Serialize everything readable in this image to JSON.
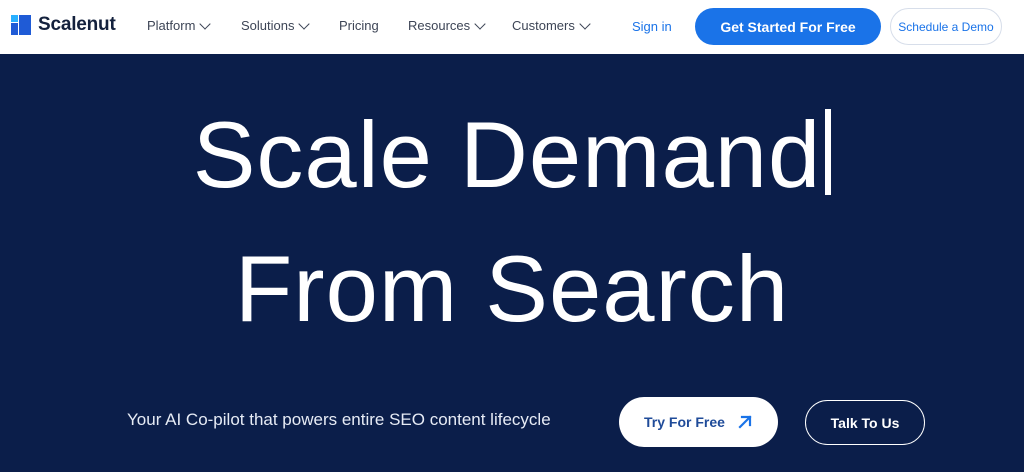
{
  "brand": {
    "name": "Scalenut",
    "colors": {
      "primary": "#1a73e8",
      "accent": "#29b0ff",
      "hero_bg": "#0b1e4a"
    }
  },
  "nav": {
    "items": [
      {
        "label": "Platform",
        "has_dropdown": true
      },
      {
        "label": "Solutions",
        "has_dropdown": true
      },
      {
        "label": "Pricing",
        "has_dropdown": false
      },
      {
        "label": "Resources",
        "has_dropdown": true
      },
      {
        "label": "Customers",
        "has_dropdown": true
      }
    ],
    "signin_label": "Sign in",
    "cta_primary": "Get Started For Free",
    "cta_secondary": "Schedule a Demo"
  },
  "hero": {
    "headline_line1": "Scale Demand",
    "headline_line2": "From Search",
    "tagline": "Your AI Co-pilot that powers entire SEO content lifecycle",
    "try_label": "Try For Free",
    "talk_label": "Talk To Us",
    "try_icon": "arrow-up-right-icon"
  }
}
